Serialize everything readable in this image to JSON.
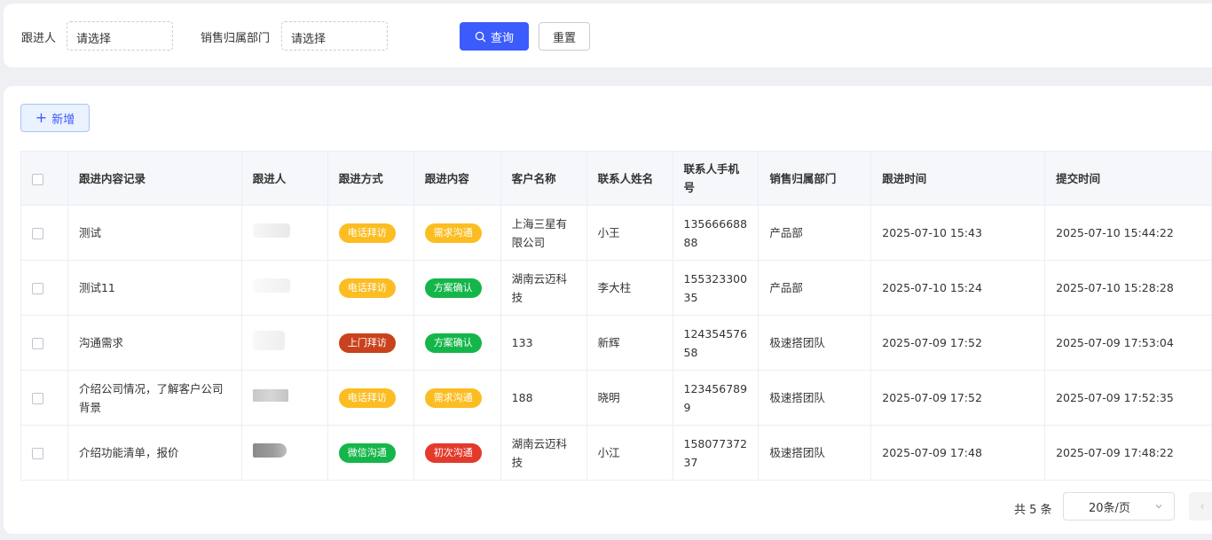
{
  "filters": {
    "follower_label": "跟进人",
    "follower_placeholder": "请选择",
    "dept_label": "销售归属部门",
    "dept_placeholder": "请选择",
    "search_label": "查询",
    "reset_label": "重置"
  },
  "toolbar": {
    "add_label": "新增"
  },
  "table": {
    "headers": [
      "跟进内容记录",
      "跟进人",
      "跟进方式",
      "跟进内容",
      "客户名称",
      "联系人姓名",
      "联系人手机号",
      "销售归属部门",
      "跟进时间",
      "提交时间"
    ],
    "rows": [
      {
        "record": "测试",
        "method": "电话拜访",
        "content": "需求沟通",
        "customer": "上海三星有限公司",
        "contact": "小王",
        "phone": "13566668888",
        "dept": "产品部",
        "follow_time": "2025-07-10 15:43",
        "submit_time": "2025-07-10 15:44:22"
      },
      {
        "record": "测试11",
        "method": "电话拜访",
        "content": "方案确认",
        "customer": "湖南云迈科技",
        "contact": "李大柱",
        "phone": "15532330035",
        "dept": "产品部",
        "follow_time": "2025-07-10 15:24",
        "submit_time": "2025-07-10 15:28:28"
      },
      {
        "record": "沟通需求",
        "method": "上门拜访",
        "content": "方案确认",
        "customer": "133",
        "contact": "新辉",
        "phone": "12435457658",
        "dept": "极速搭团队",
        "follow_time": "2025-07-09 17:52",
        "submit_time": "2025-07-09 17:53:04"
      },
      {
        "record": "介绍公司情况，了解客户公司背景",
        "method": "电话拜访",
        "content": "需求沟通",
        "customer": "188",
        "contact": "晓明",
        "phone": "1234567899",
        "dept": "极速搭团队",
        "follow_time": "2025-07-09 17:52",
        "submit_time": "2025-07-09 17:52:35"
      },
      {
        "record": "介绍功能清单，报价",
        "method": "微信沟通",
        "content": "初次沟通",
        "customer": "湖南云迈科技",
        "contact": "小江",
        "phone": "15807737237",
        "dept": "极速搭团队",
        "follow_time": "2025-07-09 17:48",
        "submit_time": "2025-07-09 17:48:22"
      }
    ]
  },
  "tag_colors": {
    "电话拜访": "#fbbd22",
    "需求沟通": "#fbbd22",
    "方案确认": "#14b64a",
    "上门拜访": "#c9421d",
    "微信沟通": "#14b64a",
    "初次沟通": "#e33a2b"
  },
  "pagination": {
    "total": "共 5 条",
    "page_size": "20条/页"
  },
  "colors": {
    "primary": "#3b5bfd",
    "header_bg": "#f5f7fa"
  }
}
